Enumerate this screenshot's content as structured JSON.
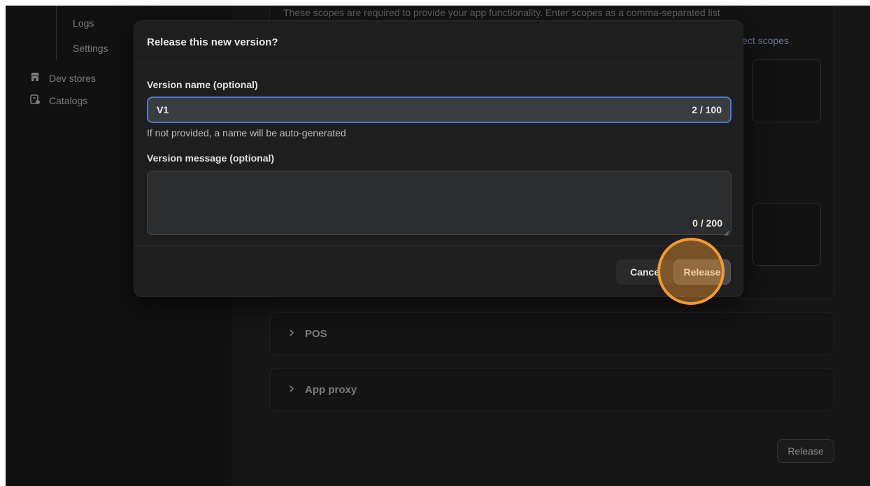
{
  "sidebar": {
    "sub_items": [
      {
        "label": "Logs"
      },
      {
        "label": "Settings"
      }
    ],
    "items": [
      {
        "label": "Dev stores",
        "icon": "store-icon"
      },
      {
        "label": "Catalogs",
        "icon": "catalog-icon"
      }
    ]
  },
  "main": {
    "scopes_description": "These scopes are required to provide your app functionality. Enter scopes as a comma-separated list",
    "select_scopes_label": "Select scopes",
    "sections": [
      {
        "label": "POS",
        "icon": "chevron-right-icon"
      },
      {
        "label": "App proxy",
        "icon": "chevron-right-icon"
      }
    ],
    "release_label": "Release"
  },
  "modal": {
    "title": "Release this new version?",
    "version_name": {
      "label": "Version name (optional)",
      "value": "V1",
      "counter": "2 / 100",
      "hint": "If not provided, a name will be auto-generated"
    },
    "version_message": {
      "label": "Version message (optional)",
      "value": "",
      "counter": "0 / 200"
    },
    "cancel_label": "Cance",
    "release_label": "Release"
  },
  "colors": {
    "accent_focus": "#4a78d6",
    "click_indicator": "#f39a34"
  }
}
